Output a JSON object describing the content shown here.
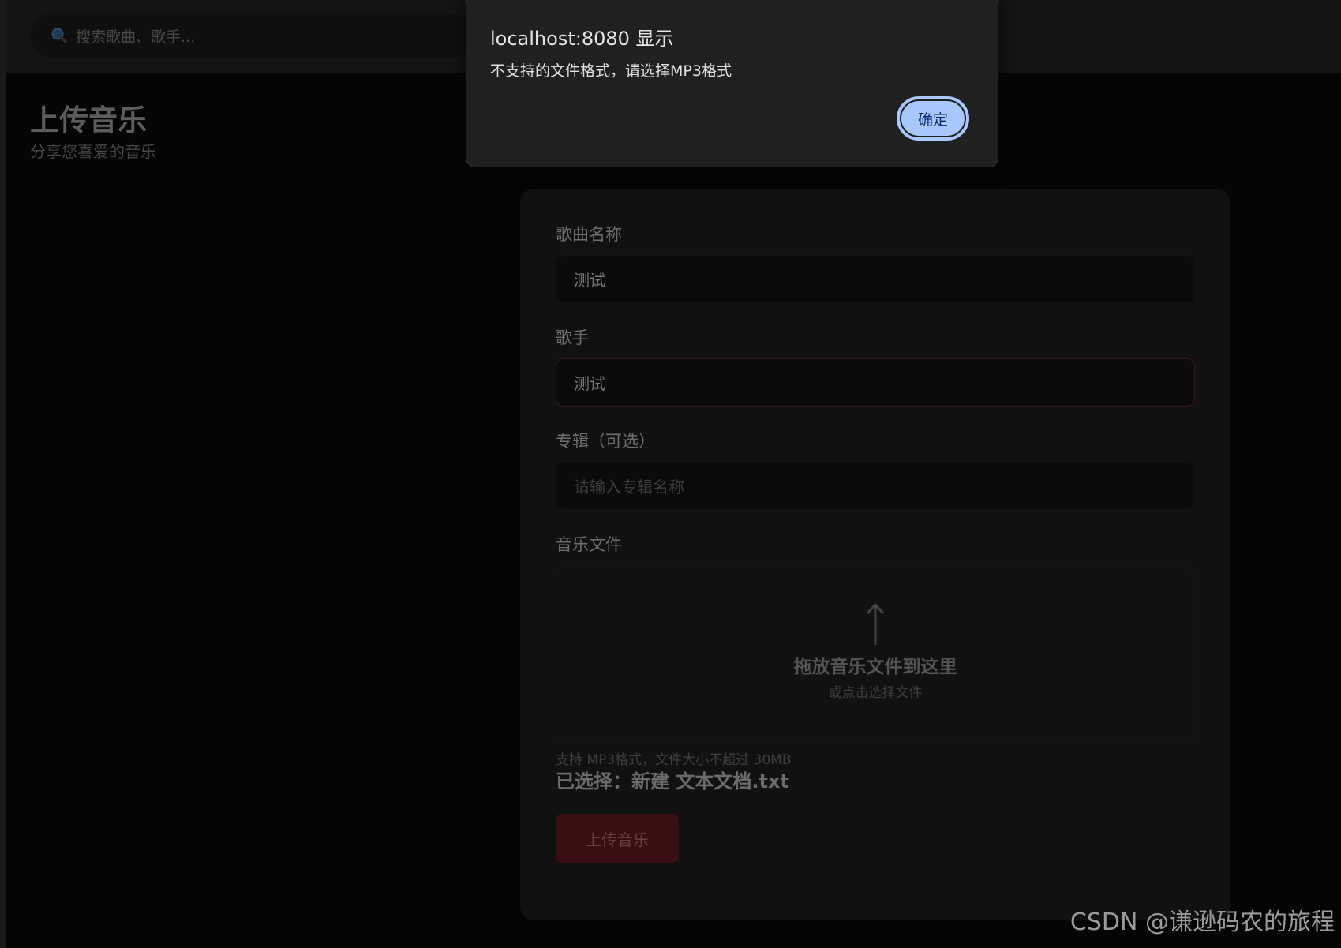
{
  "search": {
    "placeholder": "搜索歌曲、歌手..."
  },
  "page": {
    "title": "上传音乐",
    "subtitle": "分享您喜爱的音乐"
  },
  "form": {
    "song_name": {
      "label": "歌曲名称",
      "value": "测试"
    },
    "artist": {
      "label": "歌手",
      "value": "测试"
    },
    "album": {
      "label": "专辑（可选）",
      "placeholder": "请输入专辑名称"
    },
    "music_file": {
      "label": "音乐文件",
      "drop_title": "拖放音乐文件到这里",
      "drop_sub": "或点击选择文件",
      "hint": "支持 MP3格式，文件大小不超过 30MB",
      "selected_label": "已选择：",
      "selected_name": "新建 文本文档.txt"
    },
    "submit_label": "上传音乐"
  },
  "dialog": {
    "title": "localhost:8080 显示",
    "message": "不支持的文件格式，请选择MP3格式",
    "ok_label": "确定"
  },
  "watermark": "CSDN @谦逊码农的旅程",
  "colors": {
    "background": "#050505",
    "accent_button": "#3a0f12",
    "dialog_button": "#a8c7fa"
  }
}
